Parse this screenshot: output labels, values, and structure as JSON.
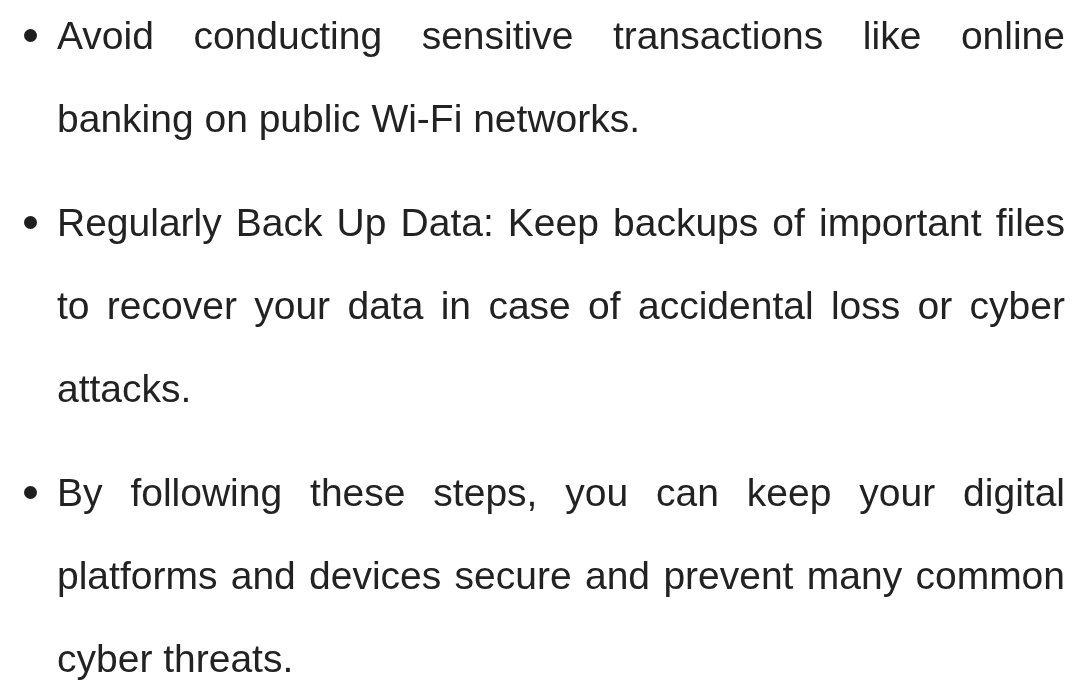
{
  "bullets": [
    {
      "text": "Avoid conducting sensitive transactions like online banking on public Wi-Fi networks."
    },
    {
      "text": "Regularly Back Up Data: Keep backups of important files to recover your data in case of accidental loss or cyber attacks."
    },
    {
      "text": "By following these steps, you can keep your digital platforms and devices secure and prevent many common cyber threats."
    }
  ]
}
